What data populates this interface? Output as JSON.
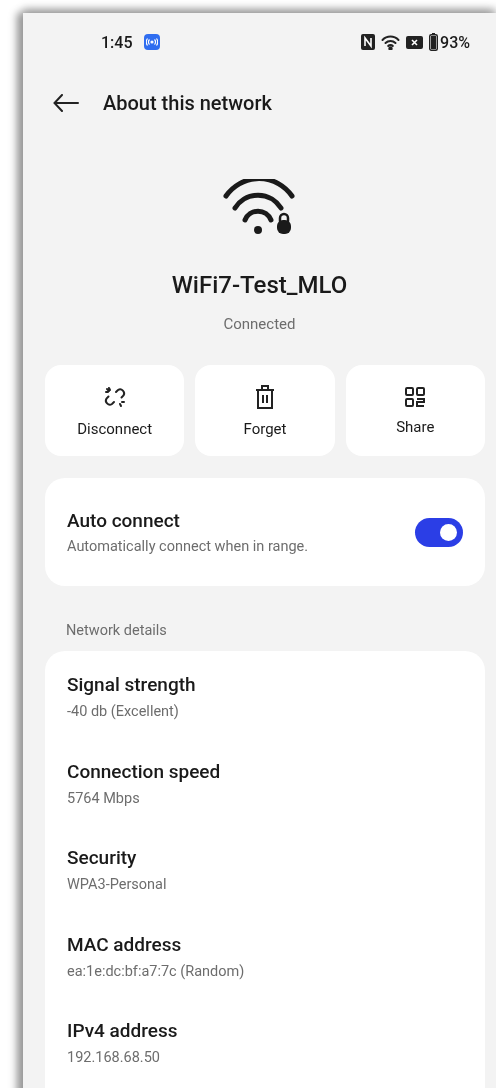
{
  "status_bar": {
    "time": "1:45",
    "battery": "93%"
  },
  "header": {
    "title": "About this network"
  },
  "network": {
    "name": "WiFi7-Test_MLO",
    "status": "Connected"
  },
  "actions": [
    {
      "kind": "disconnect",
      "label": "Disconnect"
    },
    {
      "kind": "forget",
      "label": "Forget"
    },
    {
      "kind": "share",
      "label": "Share"
    }
  ],
  "auto_connect": {
    "title": "Auto connect",
    "subtitle": "Automatically connect when in range.",
    "on": true
  },
  "details_section": {
    "title": "Network details"
  },
  "details": [
    {
      "label": "Signal strength",
      "value": "-40 db (Excellent)"
    },
    {
      "label": "Connection speed",
      "value": "5764 Mbps"
    },
    {
      "label": "Security",
      "value": "WPA3-Personal"
    },
    {
      "label": "MAC address",
      "value": "ea:1e:dc:bf:a7:7c (Random)"
    },
    {
      "label": "IPv4 address",
      "value": "192.168.68.50"
    }
  ]
}
